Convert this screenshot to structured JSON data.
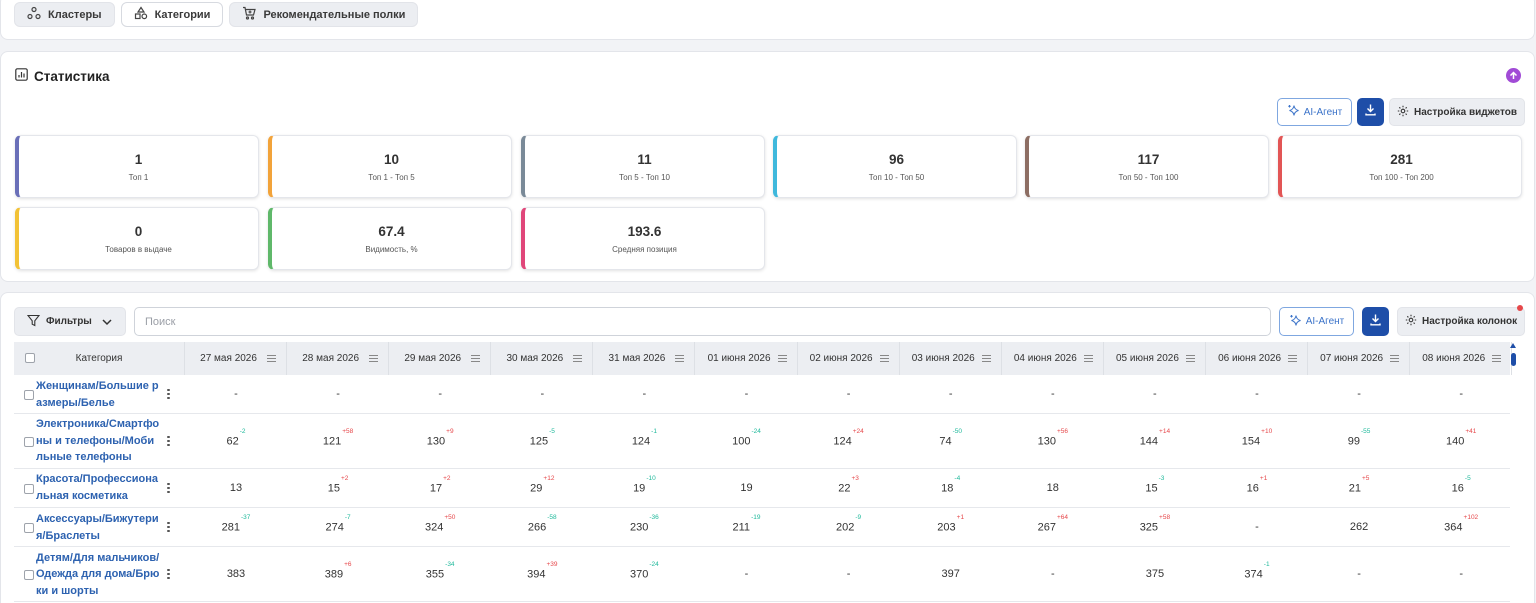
{
  "nav": {
    "buttons": [
      {
        "label": "Кластеры",
        "icon": "clusters-icon"
      },
      {
        "label": "Категории",
        "icon": "shapes-icon"
      },
      {
        "label": "Рекомендательные полки",
        "icon": "cart-icon"
      }
    ]
  },
  "stats": {
    "title": "Статистика",
    "ai_label": "AI-Агент",
    "settings_label": "Настройка виджетов",
    "tiles": [
      {
        "value": "1",
        "label": "Топ 1",
        "color": "#6a6fb8"
      },
      {
        "value": "10",
        "label": "Топ 1 - Топ 5",
        "color": "#f2a33a"
      },
      {
        "value": "11",
        "label": "Топ 5 - Топ 10",
        "color": "#7a8a98"
      },
      {
        "value": "96",
        "label": "Топ 10 - Топ 50",
        "color": "#3fb8dc"
      },
      {
        "value": "117",
        "label": "Топ 50 - Топ 100",
        "color": "#8d6e63"
      },
      {
        "value": "281",
        "label": "Топ 100 - Топ 200",
        "color": "#e25555"
      },
      {
        "value": "0",
        "label": "Товаров в выдаче",
        "color": "#f2c236"
      },
      {
        "value": "67.4",
        "label": "Видимость, %",
        "color": "#5fb86a"
      },
      {
        "value": "193.6",
        "label": "Средняя позиция",
        "color": "#e0467a"
      }
    ]
  },
  "table": {
    "filters_label": "Фильтры",
    "search_placeholder": "Поиск",
    "ai_label": "AI-Агент",
    "settings_label": "Настройка колонок",
    "category_header": "Категория",
    "dates": [
      "27 мая 2026",
      "28 мая 2026",
      "29 мая 2026",
      "30 мая 2026",
      "31 мая 2026",
      "01 июня 2026",
      "02 июня 2026",
      "03 июня 2026",
      "04 июня 2026",
      "05 июня 2026",
      "06 июня 2026",
      "07 июня 2026",
      "08 июня 2026"
    ],
    "rows": [
      {
        "category": "Женщинам/Большие размеры/Белье",
        "cells": [
          [
            "-",
            ""
          ],
          [
            "-",
            ""
          ],
          [
            "-",
            ""
          ],
          [
            "-",
            ""
          ],
          [
            "-",
            ""
          ],
          [
            "-",
            ""
          ],
          [
            "-",
            ""
          ],
          [
            "-",
            ""
          ],
          [
            "-",
            ""
          ],
          [
            "-",
            ""
          ],
          [
            "-",
            ""
          ],
          [
            "-",
            ""
          ],
          [
            "-",
            ""
          ]
        ]
      },
      {
        "category": "Электроника/Смартфоны и телефоны/Мобильные телефоны",
        "cells": [
          [
            "62",
            "-2"
          ],
          [
            "121",
            "+58"
          ],
          [
            "130",
            "+9"
          ],
          [
            "125",
            "-5"
          ],
          [
            "124",
            "-1"
          ],
          [
            "100",
            "-24"
          ],
          [
            "124",
            "+24"
          ],
          [
            "74",
            "-50"
          ],
          [
            "130",
            "+56"
          ],
          [
            "144",
            "+14"
          ],
          [
            "154",
            "+10"
          ],
          [
            "99",
            "-55"
          ],
          [
            "140",
            "+41"
          ]
        ]
      },
      {
        "category": "Красота/Профессиональная косметика",
        "cells": [
          [
            "13",
            ""
          ],
          [
            "15",
            "+2"
          ],
          [
            "17",
            "+2"
          ],
          [
            "29",
            "+12"
          ],
          [
            "19",
            "-10"
          ],
          [
            "19",
            ""
          ],
          [
            "22",
            "+3"
          ],
          [
            "18",
            "-4"
          ],
          [
            "18",
            ""
          ],
          [
            "15",
            "-3"
          ],
          [
            "16",
            "+1"
          ],
          [
            "21",
            "+5"
          ],
          [
            "16",
            "-5"
          ]
        ]
      },
      {
        "category": "Аксессуары/Бижутерия/Браслеты",
        "cells": [
          [
            "281",
            "-37"
          ],
          [
            "274",
            "-7"
          ],
          [
            "324",
            "+50"
          ],
          [
            "266",
            "-58"
          ],
          [
            "230",
            "-36"
          ],
          [
            "211",
            "-19"
          ],
          [
            "202",
            "-9"
          ],
          [
            "203",
            "+1"
          ],
          [
            "267",
            "+64"
          ],
          [
            "325",
            "+58"
          ],
          [
            "-",
            ""
          ],
          [
            "262",
            ""
          ],
          [
            "364",
            "+102"
          ]
        ]
      },
      {
        "category": "Детям/Для мальчиков/Одежда для дома/Брюки и шорты",
        "cells": [
          [
            "383",
            ""
          ],
          [
            "389",
            "+6"
          ],
          [
            "355",
            "-34"
          ],
          [
            "394",
            "+39"
          ],
          [
            "370",
            "-24"
          ],
          [
            "-",
            ""
          ],
          [
            "-",
            ""
          ],
          [
            "397",
            ""
          ],
          [
            "-",
            ""
          ],
          [
            "375",
            ""
          ],
          [
            "374",
            "-1"
          ],
          [
            "-",
            ""
          ],
          [
            "-",
            ""
          ]
        ]
      }
    ]
  }
}
